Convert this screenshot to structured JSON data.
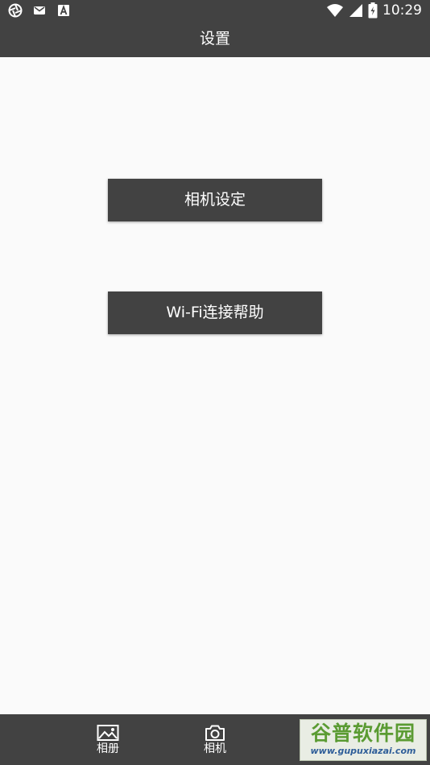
{
  "status_bar": {
    "time": "10:29",
    "left_icons": [
      "aperture-icon",
      "mail-icon",
      "font-a-icon"
    ],
    "right_icons": [
      "wifi-icon",
      "cell-signal-icon",
      "battery-charging-icon"
    ]
  },
  "app_bar": {
    "title": "设置"
  },
  "buttons": {
    "camera_settings": "相机设定",
    "wifi_help": "Wi-Fi连接帮助"
  },
  "bottom_nav": {
    "items": [
      {
        "label": "相册",
        "icon": "image-icon"
      },
      {
        "label": "相机",
        "icon": "camera-icon"
      }
    ]
  },
  "watermark": {
    "title": "谷普软件园",
    "url": "www.gupuxiazai.com"
  },
  "colors": {
    "bar": "#424242",
    "background": "#fafafa",
    "button": "#424242",
    "text": "#ffffff"
  }
}
